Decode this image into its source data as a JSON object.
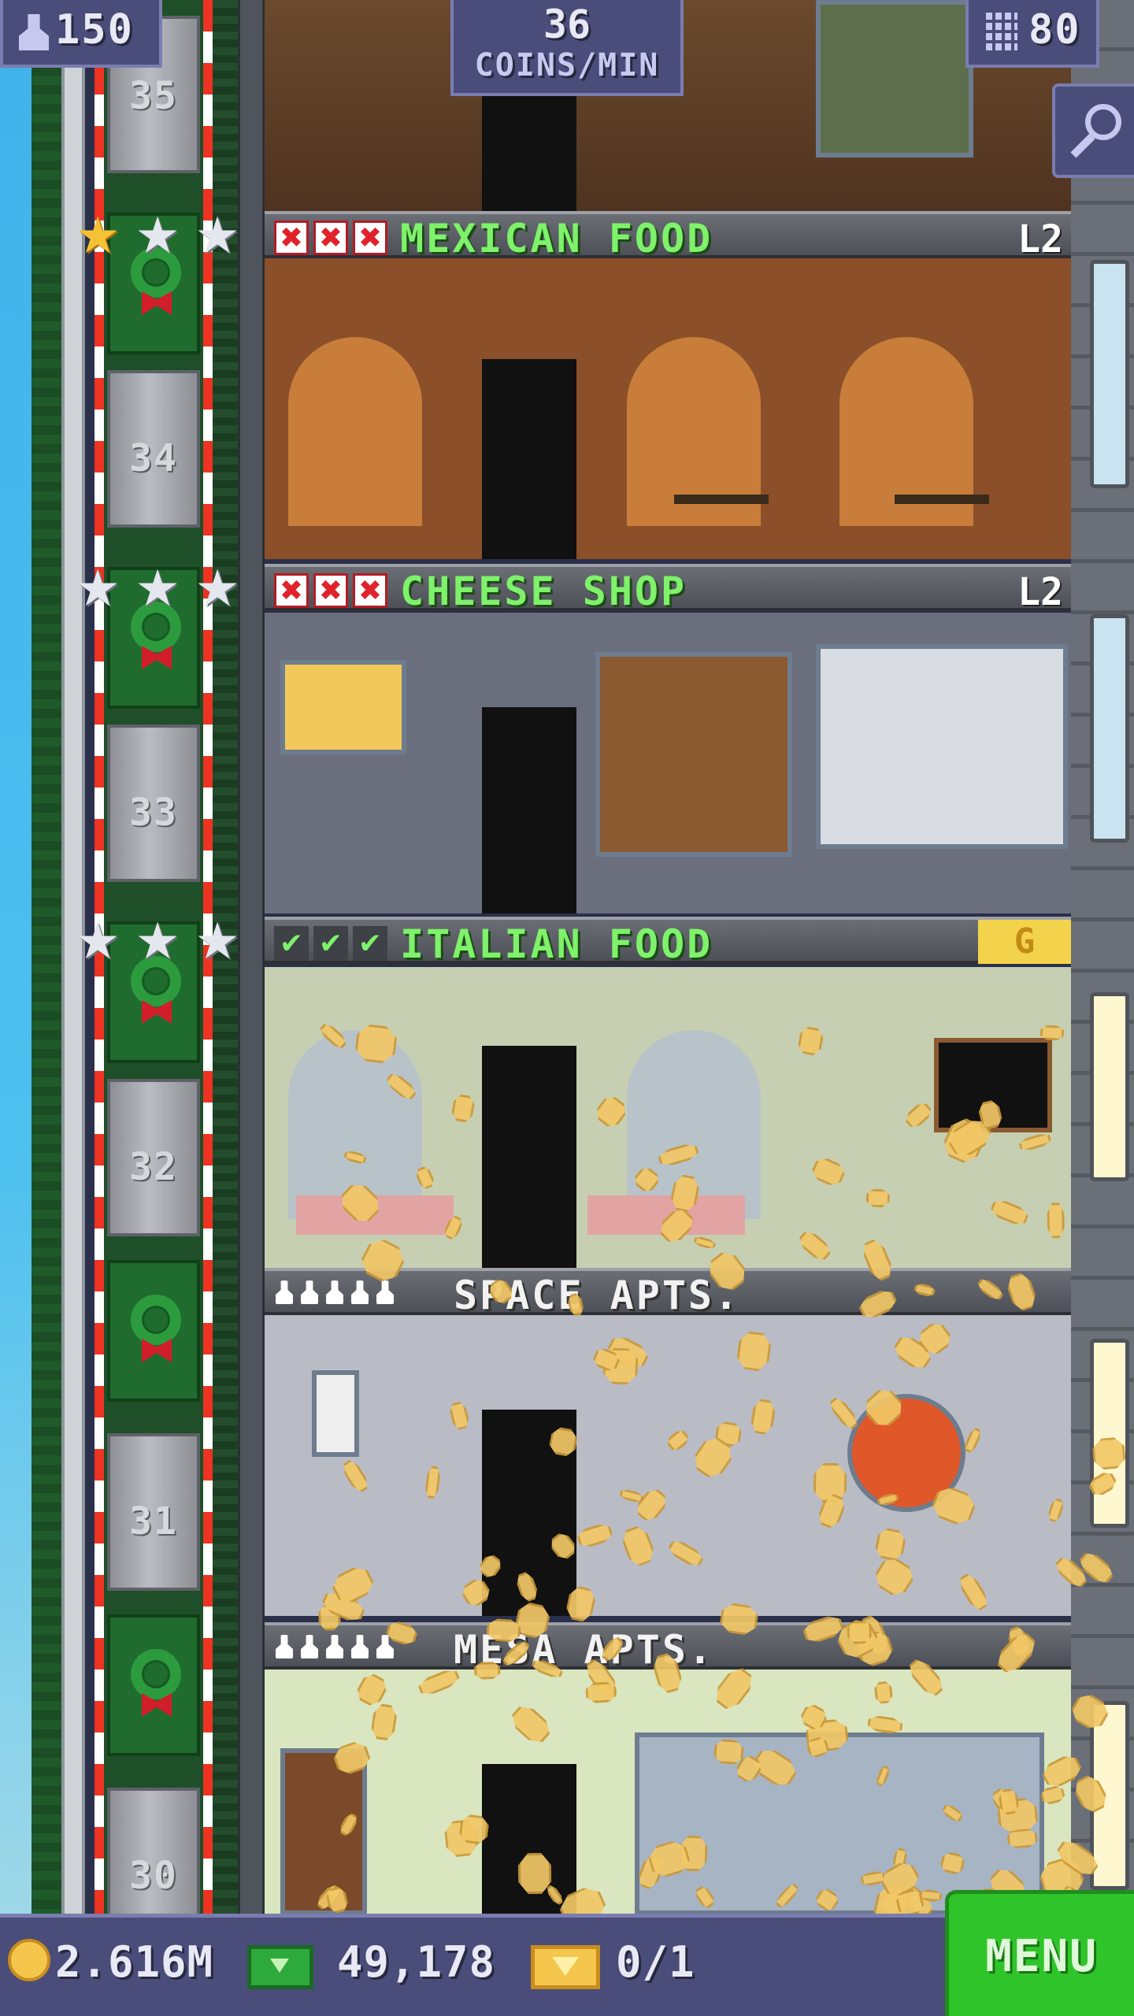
{
  "hud": {
    "population": "150",
    "coins_rate_value": "36",
    "coins_rate_unit": "COINS/MIN",
    "floor_count": "80"
  },
  "elevator": {
    "floor_numbers": [
      "35",
      "34",
      "33",
      "32",
      "31",
      "30"
    ]
  },
  "floors": [
    {
      "name": "MEXICAN FOOD",
      "level": "L2",
      "marks": [
        "x",
        "x",
        "x"
      ]
    },
    {
      "name": "CHEESE SHOP",
      "level": "L2",
      "marks": [
        "x",
        "x",
        "x"
      ]
    },
    {
      "name": "ITALIAN FOOD",
      "level": "G",
      "marks": [
        "check",
        "check",
        "check"
      ]
    },
    {
      "name": "SPACE APTS."
    },
    {
      "name": "MESA APTS."
    }
  ],
  "bottom_bar": {
    "coins": "2.616M",
    "bux": "49,178",
    "tickets": "0/1",
    "menu_label": "MENU"
  },
  "colors": {
    "hud_bg": "#4a4c79",
    "business_label": "#7ef26a",
    "menu_green": "#2fc52a",
    "star_gold": "#f6c235"
  },
  "icons": {
    "population": "person-icon",
    "floors": "building-icon",
    "zoom": "magnifier-icon",
    "coins": "coin-icon",
    "bux": "cash-icon",
    "tickets": "ticket-icon"
  }
}
